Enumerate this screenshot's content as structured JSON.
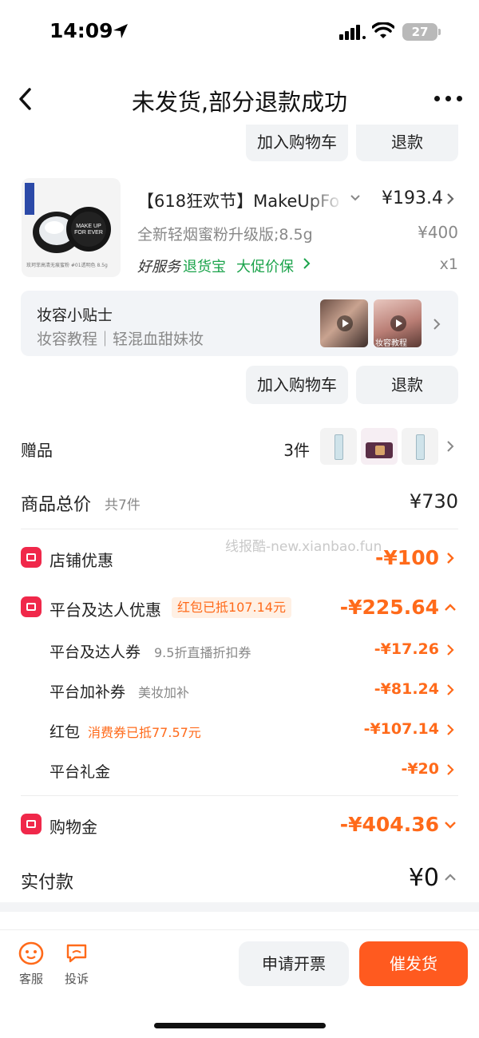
{
  "status_bar": {
    "time": "14:09",
    "battery": "27"
  },
  "nav": {
    "title": "未发货,部分退款成功"
  },
  "top_actions": {
    "add_to_cart": "加入购物车",
    "refund": "退款"
  },
  "product": {
    "title": "【618狂欢节】MakeUpFo",
    "price": "¥193.4",
    "spec": "全新轻烟蜜粉升级版;8.5g",
    "original_price": "¥400",
    "service_good": "好服务",
    "service_return": "退货宝",
    "service_price_protect": "大促价保",
    "quantity": "x1",
    "thumb_caption": "玫珂菲高清无痕蜜粉 #01透明色 8.5g"
  },
  "tips": {
    "title": "妆容小贴士",
    "subtitle": "妆容教程｜轻混血甜妹妆",
    "video_caption": "妆容教程"
  },
  "item_actions": {
    "add_to_cart": "加入购物车",
    "refund": "退款"
  },
  "gift": {
    "label": "赠品",
    "count": "3件"
  },
  "summary": {
    "total_label": "商品总价",
    "total_count": "共7件",
    "total_value": "¥730",
    "store_discount_label": "店铺优惠",
    "store_discount_value": "-¥100",
    "platform_label": "平台及达人优惠",
    "platform_tag": "红包已抵107.14元",
    "platform_value": "-¥225.64",
    "sub_items": [
      {
        "label": "平台及达人券",
        "note": "9.5折直播折扣券",
        "value": "-¥17.26"
      },
      {
        "label": "平台加补券",
        "note": "美妆加补",
        "value": "-¥81.24"
      },
      {
        "label": "红包",
        "note": "消费券已抵77.57元",
        "value": "-¥107.14"
      },
      {
        "label": "平台礼金",
        "note": "",
        "value": "-¥20"
      }
    ],
    "shopping_gold_label": "购物金",
    "shopping_gold_value": "-¥404.36",
    "paid_label": "实付款",
    "paid_value": "¥0"
  },
  "watermark": "线报酷-new.xianbao.fun",
  "bottom": {
    "cs": "客服",
    "complain": "投诉",
    "invoice": "申请开票",
    "urge": "催发货"
  },
  "colors": {
    "accent": "#ff5a1f",
    "discount": "#ff6a1a",
    "service_green": "#1aa34a",
    "icon_red": "#f0284a"
  }
}
